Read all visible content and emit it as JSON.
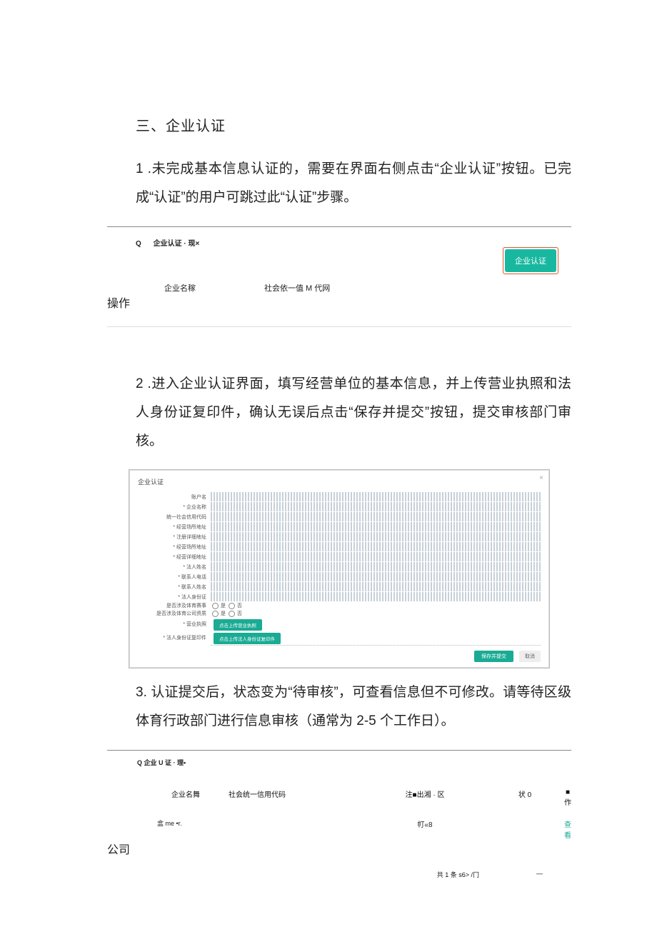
{
  "heading": "三、企业认证",
  "para1": "1 .未完成基本信息认证的，需要在界面右侧点击“企业认证”按钮。已完成“认证”的用户可跳过此“认证”步骤。",
  "para2": "2  .进入企业认证界面，填写经营单位的基本信息，并上传营业执照和法人身份证复印件，确认无误后点击“保存并提交”按钮，提交审核部门审核。",
  "para3": "3. 认证提交后，状态变为“待审核”，可查看信息但不可修改。请等待区级体育行政部门进行信息审核（通常为 2-5 个工作日）。",
  "fig1": {
    "icon": "Q",
    "tab": "企业认证 · 现×",
    "button": "企业认证",
    "col1": "企业名稼",
    "col2": "社会依一值 M 代网",
    "col_op": "操作"
  },
  "fig2": {
    "title": "企业认证",
    "rows": [
      {
        "label": "账户名",
        "value": ""
      },
      {
        "label": "* 企业名称",
        "value": ""
      },
      {
        "label": "统一社会信用代码",
        "value": ""
      },
      {
        "label": "* 经营场所地址",
        "value": ""
      },
      {
        "label": "* 注册详细地址",
        "value": ""
      },
      {
        "label": "* 经营场所地址",
        "value": ""
      },
      {
        "label": "* 经营详细地址",
        "value": ""
      },
      {
        "label": "* 法人姓名",
        "value": ""
      },
      {
        "label": "* 联系人电话",
        "value": ""
      },
      {
        "label": "* 联系人姓名",
        "value": ""
      },
      {
        "label": "* 法人身份证",
        "value": ""
      }
    ],
    "radio1_label": "是否涉及体育赛事",
    "radio2_label": "是否涉及体育公司资质",
    "opt_yes": "是",
    "opt_no": "否",
    "upload1_label": "* 营业执照",
    "upload1_btn": "点击上传营业执照",
    "upload2_label": "* 法人身份证复印件",
    "upload2_btn": "点击上传法人身份证复印件",
    "save": "保存并提交",
    "cancel": "取消"
  },
  "fig3": {
    "tab": "Q 企业 U 证 · 理•",
    "h1": "企业名舞",
    "h2": "社会统一信用代码",
    "h3": "注■出湘 · 区",
    "h4": "状 0",
    "h5": "■作",
    "r1c1": "盒 me •r.",
    "r1c1b": "公司",
    "r1c3": "帄«8",
    "r1c5": "查看",
    "pager_left": "共 1 条 s6> /冂",
    "pager_right": "—"
  }
}
